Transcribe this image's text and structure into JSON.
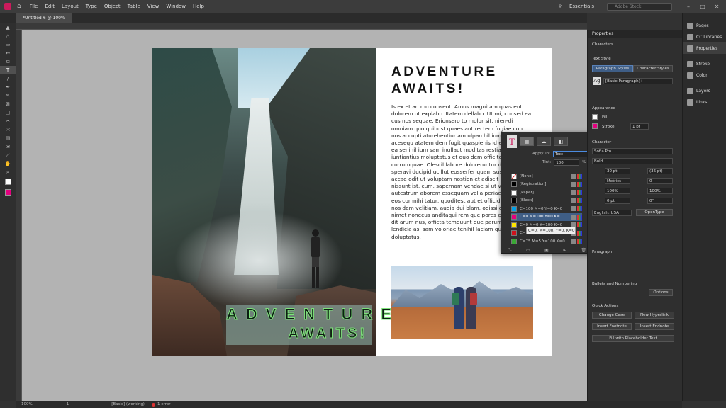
{
  "app": {
    "menu": [
      "File",
      "Edit",
      "Layout",
      "Type",
      "Object",
      "Table",
      "View",
      "Window",
      "Help"
    ],
    "workspace": "Essentials",
    "search_placeholder": "Adobe Stock"
  },
  "document": {
    "tab_title": "*Untitled-6 @ 100%"
  },
  "toolbar_icons": [
    "selection-icon",
    "direct-selection-icon",
    "page-icon",
    "gap-icon",
    "content-collector-icon",
    "type-icon",
    "line-icon",
    "pen-icon",
    "pencil-icon",
    "rectangle-frame-icon",
    "rectangle-icon",
    "scissors-icon",
    "free-transform-icon",
    "gradient-icon",
    "note-icon",
    "eyedropper-icon",
    "hand-icon",
    "zoom-icon"
  ],
  "page": {
    "heading_line1": "ADVENTURE",
    "heading_line2": "AWAITS!",
    "overlay_line1": "ADVENTURE",
    "overlay_line2": "AWAITS!",
    "body": "Is ex et ad mo consent. Amus magnitam quas enti dolorem ut explabo. Itatem dellabo. Ut mi, consed ea cus nos sequae. Erionsero to molor sit, nien-di omniam quo quibust quaes aut rectem fugiae con nos accupti aturehentiur am ulparchil ium cor acesequ atatem dem fugit quaspienis id eium a vel ea senihil ium sam inullaut moditas restiae iuntiantius moluptatus et quo dem offic totatemo corrumquae. Olescil labore doloreruntur dolorer speravi ducipid ucillut eosserfer quam susdae nihit accae odit ut voluptam nostion et adiscit eaquame nissunt ist, cum, sapernam vendae si ut velenda esti autestrum aborem essequam vella periae dolorroris eos comnihi tatur, quoditest aut et officid magnim ne nos dem velitiam, audia dui blam, odissi consequi te nimet nonecus anditaqui rem que pores cuscil alicius dit arum nus, officta temquunt que parum harchil lendicia asi sam voloriae tenihil laciam quae doluptatus."
  },
  "swatches": {
    "apply_to_label": "Apply To:",
    "apply_to_value": "Text",
    "tint_label": "Tint:",
    "tint_value": "100",
    "tint_unit": "%",
    "items": [
      {
        "name": "[None]",
        "color": "#ffffff"
      },
      {
        "name": "[Registration]",
        "color": "#000000"
      },
      {
        "name": "[Paper]",
        "color": "#ffffff"
      },
      {
        "name": "[Black]",
        "color": "#000000"
      },
      {
        "name": "C=100 M=0 Y=0 K=0",
        "color": "#00a0e6"
      },
      {
        "name": "C=0 M=100 Y=0 K=...",
        "color": "#e4007f"
      },
      {
        "name": "C=0 M=0 Y=100 K=0",
        "color": "#ffe600"
      },
      {
        "name": "C=15 M=100 Y=100...",
        "color": "#d0121b"
      },
      {
        "name": "C=75 M=5 Y=100 K=0",
        "color": "#3aa935"
      }
    ],
    "selected_index": 5,
    "tooltip": "C=0, M=100, Y=0, K=0"
  },
  "properties": {
    "title": "Properties",
    "section": "Characters",
    "text_style_label": "Text Style",
    "paragraph_styles_tab": "Paragraph Styles",
    "character_styles_tab": "Character Styles",
    "style_value": "[Basic Paragraph]+",
    "appearance_label": "Appearance",
    "fill_label": "Fill",
    "stroke_label": "Stroke",
    "stroke_value": "1 pt",
    "character_label": "Character",
    "font_value": "Sofia Pro",
    "weight_value": "Bold",
    "size_value": "30 pt",
    "leading_value": "(36 pt)",
    "kerning_value": "Metrics",
    "tracking_value": "0",
    "hscale_value": "100%",
    "vscale_value": "100%",
    "baseline_value": "0 pt",
    "skew_value": "0°",
    "language_value": "English: USA",
    "opentype_label": "OpenType",
    "paragraph_label": "Paragraph",
    "bullets_label": "Bullets and Numbering",
    "options_button": "Options",
    "quick_actions_label": "Quick Actions",
    "change_case": "Change Case",
    "new_hyperlink": "New Hyperlink",
    "insert_footnote": "Insert Footnote",
    "insert_endnote": "Insert Endnote",
    "fill_placeholder": "Fill with Placeholder Text"
  },
  "dock": [
    "Pages",
    "CC Libraries",
    "Properties",
    "Stroke",
    "Color",
    "Layers",
    "Links"
  ],
  "status": {
    "zoom": "100%",
    "page_num": "1",
    "style": "[Basic] (working)",
    "errors": "1 error"
  }
}
